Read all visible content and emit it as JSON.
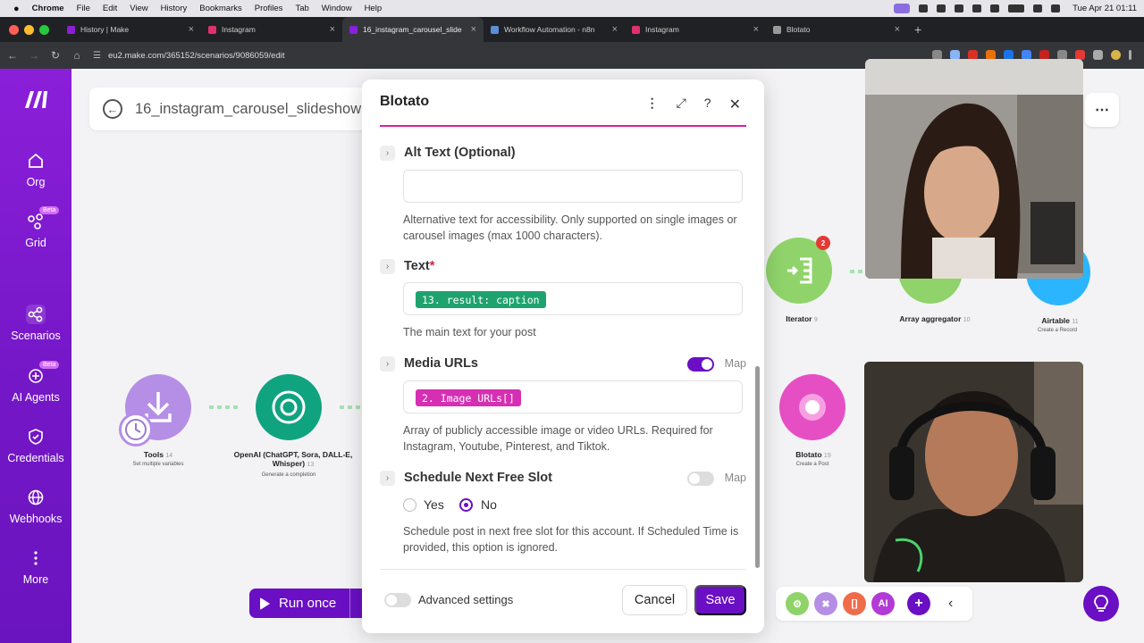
{
  "menubar": {
    "app": "Chrome",
    "items": [
      "File",
      "Edit",
      "View",
      "History",
      "Bookmarks",
      "Profiles",
      "Tab",
      "Window",
      "Help"
    ],
    "clock": "Tue Apr 21  01:11"
  },
  "tabs": [
    {
      "title": "History | Make",
      "color": "#8b1fd9"
    },
    {
      "title": "Instagram",
      "color": "#e1306c"
    },
    {
      "title": "16_instagram_carousel_slide",
      "color": "#8b1fd9"
    },
    {
      "title": "Workflow Automation - n8n",
      "color": "#5a8fd8"
    },
    {
      "title": "Instagram",
      "color": "#e1306c"
    },
    {
      "title": "Blotato",
      "color": "#999999"
    }
  ],
  "address": {
    "url": "eu2.make.com/365152/scenarios/9086059/edit"
  },
  "sidebar": {
    "items": [
      {
        "label": "Org",
        "icon": "home-icon"
      },
      {
        "label": "Grid",
        "icon": "grid-icon",
        "badge": "Beta"
      },
      {
        "label": "Scenarios",
        "icon": "share-icon"
      },
      {
        "label": "AI Agents",
        "icon": "ai-agent-icon",
        "badge": "Beta"
      },
      {
        "label": "Credentials",
        "icon": "key-icon"
      },
      {
        "label": "Webhooks",
        "icon": "globe-icon"
      },
      {
        "label": "More",
        "icon": "more-icon"
      }
    ]
  },
  "header": {
    "title": "16_instagram_carousel_slideshow"
  },
  "nodes": {
    "tools": {
      "label": "Tools",
      "num": "14",
      "sub": "Set multiple variables"
    },
    "openai": {
      "label": "OpenAI (ChatGPT, Sora, DALL-E, Whisper)",
      "num": "13",
      "sub": "Generate a completion"
    },
    "iterator": {
      "label": "Iterator",
      "num": "9",
      "badge": "2"
    },
    "aggregator": {
      "label": "Array aggregator",
      "num": "10"
    },
    "airtable": {
      "label": "Airtable",
      "num": "11",
      "sub": "Create a Record"
    },
    "blotato": {
      "label": "Blotato",
      "num": "19",
      "sub": "Create a Post"
    }
  },
  "run": {
    "label": "Run once"
  },
  "modal": {
    "title": "Blotato",
    "alt_text": {
      "label": "Alt Text (Optional)",
      "help": "Alternative text for accessibility. Only supported on single images or carousel images (max 1000 characters)."
    },
    "text": {
      "label": "Text",
      "required": "*",
      "chip": "13. result: caption",
      "help": "The main text for your post"
    },
    "media": {
      "label": "Media URLs",
      "map": "Map",
      "chip": "2. Image URLs[]",
      "help": "Array of publicly accessible image or video URLs. Required for Instagram, Youtube, Pinterest, and Tiktok."
    },
    "schedule": {
      "label": "Schedule Next Free Slot",
      "map": "Map",
      "yes": "Yes",
      "no": "No",
      "help": "Schedule post in next free slot for this account. If Scheduled Time is provided, this option is ignored."
    },
    "advanced": "Advanced settings",
    "cancel": "Cancel",
    "save": "Save"
  },
  "colors": {
    "brand": "#6a0fc4",
    "accent": "#d81fa8",
    "chip_green": "#1fa36e",
    "chip_pink": "#d62fb3"
  }
}
